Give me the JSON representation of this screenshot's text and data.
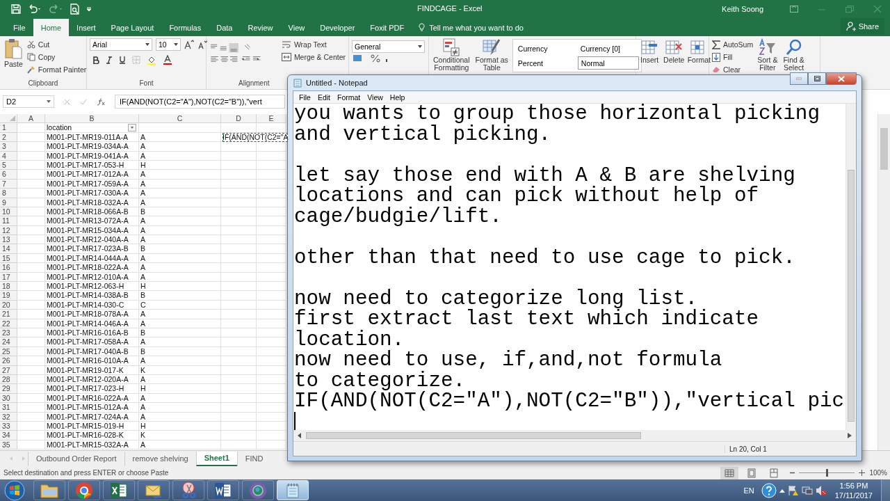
{
  "excel": {
    "title": "FINDCAGE  -  Excel",
    "user": "Keith Soong",
    "tabs": [
      {
        "label": "File",
        "selected": false
      },
      {
        "label": "Home",
        "selected": true
      },
      {
        "label": "Insert",
        "selected": false
      },
      {
        "label": "Page Layout",
        "selected": false
      },
      {
        "label": "Formulas",
        "selected": false
      },
      {
        "label": "Data",
        "selected": false
      },
      {
        "label": "Review",
        "selected": false
      },
      {
        "label": "View",
        "selected": false
      },
      {
        "label": "Developer",
        "selected": false
      },
      {
        "label": "Foxit PDF",
        "selected": false
      }
    ],
    "tell_me": {
      "placeholder": "Tell me what you want to do"
    },
    "share": "Share",
    "ribbon": {
      "clipboard": {
        "label": "Clipboard",
        "paste": "Paste",
        "cut": "Cut",
        "copy": "Copy",
        "format_painter": "Format Painter"
      },
      "font": {
        "label": "Font",
        "name": "Arial",
        "size": "10"
      },
      "alignment": {
        "label": "Alignment",
        "wrap": "Wrap Text",
        "merge": "Merge & Center"
      },
      "number": {
        "format": "General"
      },
      "styles": {
        "conditional": [
          "Conditional",
          "Formatting"
        ],
        "table": [
          "Format as",
          "Table"
        ],
        "cell_styles": [
          {
            "label": "Currency",
            "selected": false
          },
          {
            "label": "Currency [0]",
            "selected": false
          },
          {
            "label": "Percent",
            "selected": false
          },
          {
            "label": "Normal",
            "selected": true
          }
        ]
      },
      "cells": [
        "Insert",
        "Delete",
        "Format"
      ],
      "editing": {
        "autosum": "AutoSum",
        "fill": "Fill",
        "clear": "Clear",
        "sort": [
          "Sort &",
          "Filter"
        ],
        "find": [
          "Find &",
          "Select"
        ]
      }
    },
    "name_box": "D2",
    "formula": "IF(AND(NOT(C2=\"A\"),NOT(C2=\"B\")),\"vert",
    "sheet": {
      "columns": [
        "A",
        "B",
        "C",
        "D",
        "E"
      ],
      "header_row": {
        "number": "1",
        "location": "location",
        "filter": true
      },
      "active_cell": {
        "text": "IF(AND(NOT(C2=\"A",
        "copy_marquee": true
      },
      "rows": [
        {
          "number": "2",
          "location": "M001-PLT-MR19-011A-A",
          "code": "A"
        },
        {
          "number": "3",
          "location": "M001-PLT-MR19-034A-A",
          "code": "A"
        },
        {
          "number": "4",
          "location": "M001-PLT-MR19-041A-A",
          "code": "A"
        },
        {
          "number": "5",
          "location": "M001-PLT-MR17-053-H",
          "code": "H"
        },
        {
          "number": "6",
          "location": "M001-PLT-MR17-012A-A",
          "code": "A"
        },
        {
          "number": "7",
          "location": "M001-PLT-MR17-059A-A",
          "code": "A"
        },
        {
          "number": "8",
          "location": "M001-PLT-MR17-030A-A",
          "code": "A"
        },
        {
          "number": "9",
          "location": "M001-PLT-MR18-032A-A",
          "code": "A"
        },
        {
          "number": "10",
          "location": "M001-PLT-MR18-066A-B",
          "code": "B"
        },
        {
          "number": "11",
          "location": "M001-PLT-MR13-072A-A",
          "code": "A"
        },
        {
          "number": "12",
          "location": "M001-PLT-MR15-034A-A",
          "code": "A"
        },
        {
          "number": "13",
          "location": "M001-PLT-MR12-040A-A",
          "code": "A"
        },
        {
          "number": "14",
          "location": "M001-PLT-MR17-023A-B",
          "code": "B"
        },
        {
          "number": "15",
          "location": "M001-PLT-MR14-044A-A",
          "code": "A"
        },
        {
          "number": "16",
          "location": "M001-PLT-MR18-022A-A",
          "code": "A"
        },
        {
          "number": "17",
          "location": "M001-PLT-MR12-010A-A",
          "code": "A"
        },
        {
          "number": "18",
          "location": "M001-PLT-MR12-063-H",
          "code": "H"
        },
        {
          "number": "19",
          "location": "M001-PLT-MR14-038A-B",
          "code": "B"
        },
        {
          "number": "20",
          "location": "M001-PLT-MR14-030-C",
          "code": "C"
        },
        {
          "number": "21",
          "location": "M001-PLT-MR18-078A-A",
          "code": "A"
        },
        {
          "number": "22",
          "location": "M001-PLT-MR14-046A-A",
          "code": "A"
        },
        {
          "number": "23",
          "location": "M001-PLT-MR16-016A-B",
          "code": "B"
        },
        {
          "number": "24",
          "location": "M001-PLT-MR17-058A-A",
          "code": "A"
        },
        {
          "number": "25",
          "location": "M001-PLT-MR17-040A-B",
          "code": "B"
        },
        {
          "number": "26",
          "location": "M001-PLT-MR16-010A-A",
          "code": "A"
        },
        {
          "number": "27",
          "location": "M001-PLT-MR19-017-K",
          "code": "K"
        },
        {
          "number": "28",
          "location": "M001-PLT-MR12-020A-A",
          "code": "A"
        },
        {
          "number": "29",
          "location": "M001-PLT-MR17-023-H",
          "code": "H"
        },
        {
          "number": "30",
          "location": "M001-PLT-MR16-022A-A",
          "code": "A"
        },
        {
          "number": "31",
          "location": "M001-PLT-MR15-012A-A",
          "code": "A"
        },
        {
          "number": "32",
          "location": "M001-PLT-MR17-024A-A",
          "code": "A"
        },
        {
          "number": "33",
          "location": "M001-PLT-MR15-019-H",
          "code": "H"
        },
        {
          "number": "34",
          "location": "M001-PLT-MR16-028-K",
          "code": "K"
        },
        {
          "number": "35",
          "location": "M001-PLT-MR15-032A-A",
          "code": "A"
        }
      ]
    },
    "sheet_tabs": [
      {
        "label": "Outbound Order Report",
        "selected": false
      },
      {
        "label": "remove shelving",
        "selected": false
      },
      {
        "label": "Sheet1",
        "selected": true
      },
      {
        "label": "FIND",
        "selected": false
      }
    ],
    "status": "Select destination and press ENTER or choose Paste",
    "zoom": {
      "level": 0.5,
      "reading": "100%"
    }
  },
  "notepad": {
    "title": "Untitled - Notepad",
    "menu": [
      "File",
      "Edit",
      "Format",
      "View",
      "Help"
    ],
    "paragraphs": [
      [
        "you wants to group those horizontal picking",
        "and vertical picking."
      ],
      [
        "let say those end with A & B are shelving",
        "locations and can pick without help of",
        "cage/budgie/lift."
      ],
      [
        "other than that need to use cage to pick."
      ],
      [
        "now need to categorize long list.",
        "first extract last text which indicate",
        "location.",
        "now need to use, if,and,not formula",
        "to categorize.",
        "IF(AND(NOT(C2=\"A\"),NOT(C2=\"B\")),\"vertical pic"
      ]
    ],
    "status": "Ln 20, Col 1"
  },
  "taskbar": {
    "apps": [
      {
        "kind": "folder",
        "selected": false
      },
      {
        "kind": "chrome",
        "selected": false
      },
      {
        "kind": "excel",
        "selected": false
      },
      {
        "kind": "mail",
        "selected": false
      },
      {
        "kind": "scissors",
        "selected": false
      },
      {
        "kind": "word",
        "selected": false
      },
      {
        "kind": "globe",
        "selected": false
      },
      {
        "kind": "notepad",
        "selected": true
      }
    ],
    "language": "EN",
    "time": "1:56 PM",
    "date": "17/11/2017"
  }
}
